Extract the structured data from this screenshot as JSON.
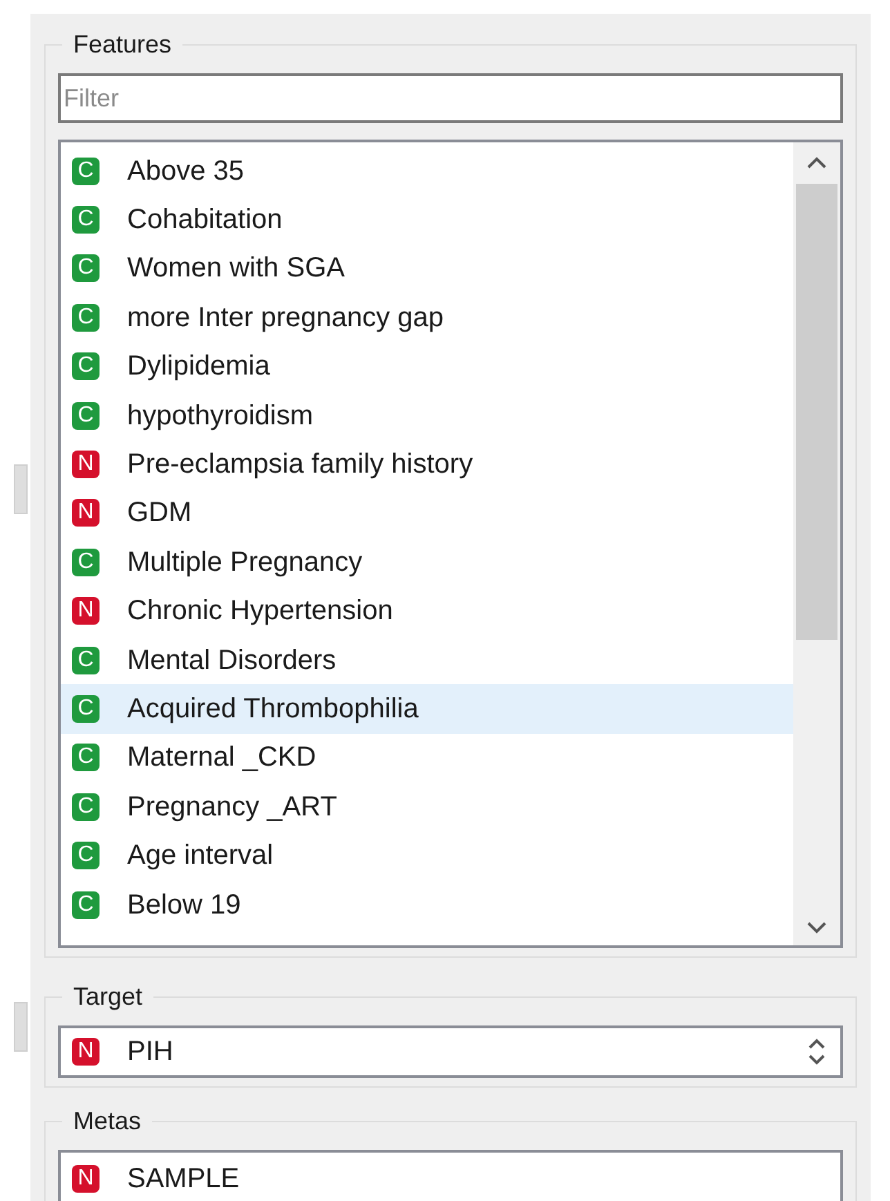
{
  "features": {
    "title": "Features",
    "filter": {
      "placeholder": "Filter"
    },
    "items": [
      {
        "name": "Above 35",
        "kind": "categorical",
        "badge": "C",
        "selected": false
      },
      {
        "name": "Cohabitation",
        "kind": "categorical",
        "badge": "C",
        "selected": false
      },
      {
        "name": "Women with SGA",
        "kind": "categorical",
        "badge": "C",
        "selected": false
      },
      {
        "name": "more Inter pregnancy gap",
        "kind": "categorical",
        "badge": "C",
        "selected": false
      },
      {
        "name": "Dylipidemia",
        "kind": "categorical",
        "badge": "C",
        "selected": false
      },
      {
        "name": "hypothyroidism",
        "kind": "categorical",
        "badge": "C",
        "selected": false
      },
      {
        "name": "Pre-eclampsia family history",
        "kind": "numeric",
        "badge": "N",
        "selected": false
      },
      {
        "name": "GDM",
        "kind": "numeric",
        "badge": "N",
        "selected": false
      },
      {
        "name": "Multiple Pregnancy",
        "kind": "categorical",
        "badge": "C",
        "selected": false
      },
      {
        "name": "Chronic Hypertension",
        "kind": "numeric",
        "badge": "N",
        "selected": false
      },
      {
        "name": "Mental Disorders",
        "kind": "categorical",
        "badge": "C",
        "selected": false
      },
      {
        "name": "Acquired Thrombophilia",
        "kind": "categorical",
        "badge": "C",
        "selected": true
      },
      {
        "name": "Maternal _CKD",
        "kind": "categorical",
        "badge": "C",
        "selected": false
      },
      {
        "name": "Pregnancy _ART",
        "kind": "categorical",
        "badge": "C",
        "selected": false
      },
      {
        "name": "Age interval",
        "kind": "categorical",
        "badge": "C",
        "selected": false
      },
      {
        "name": "Below 19",
        "kind": "categorical",
        "badge": "C",
        "selected": false
      }
    ]
  },
  "target": {
    "title": "Target",
    "value": {
      "name": "PIH",
      "kind": "numeric",
      "badge": "N"
    }
  },
  "metas": {
    "title": "Metas",
    "items": [
      {
        "name": "SAMPLE",
        "kind": "numeric",
        "badge": "N"
      }
    ]
  }
}
